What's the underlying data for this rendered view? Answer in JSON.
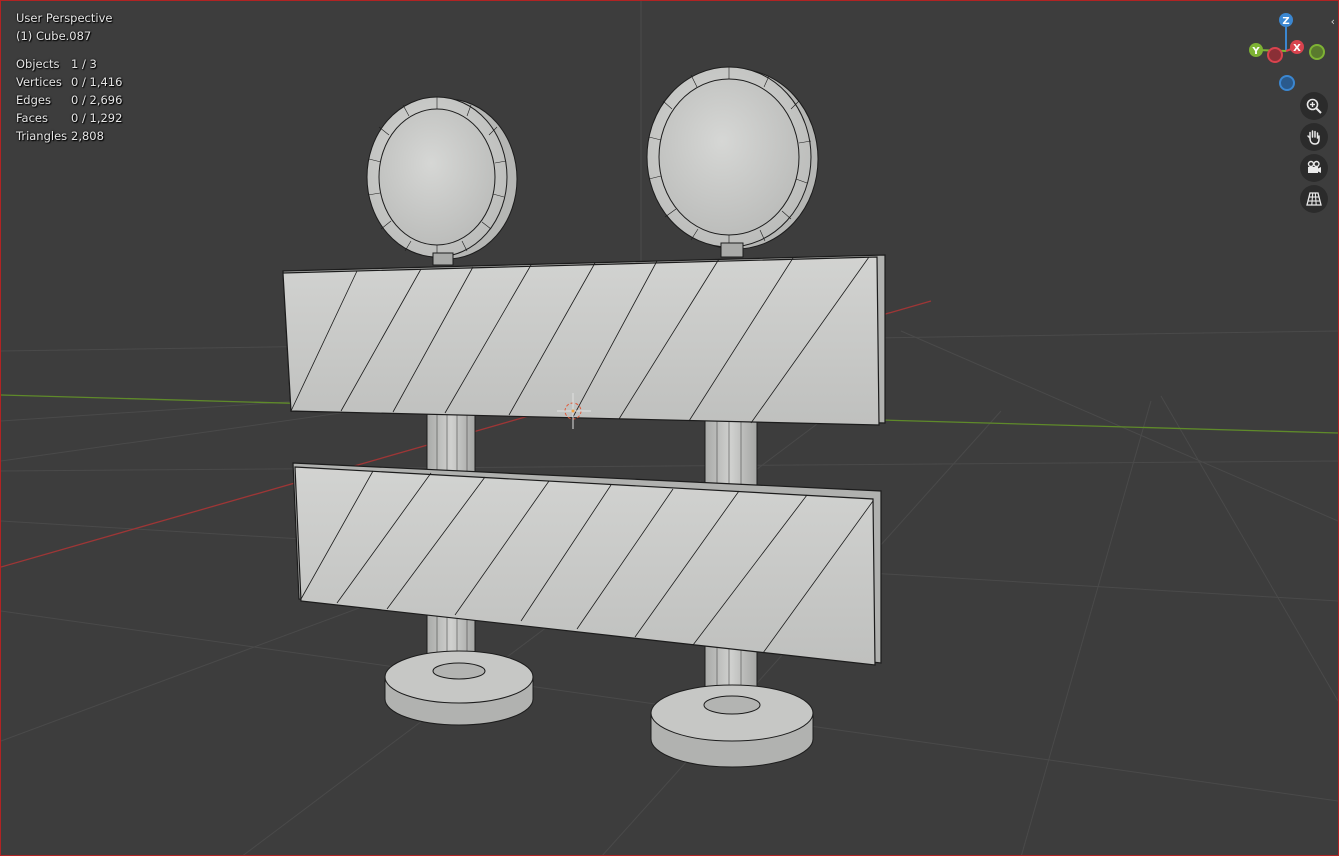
{
  "viewport": {
    "view_name": "User Perspective",
    "object_name": "(1) Cube.087"
  },
  "stats": [
    {
      "label": "Objects",
      "value": "1 / 3"
    },
    {
      "label": "Vertices",
      "value": "0 / 1,416"
    },
    {
      "label": "Edges",
      "value": "0 / 2,696"
    },
    {
      "label": "Faces",
      "value": "0 / 1,292"
    },
    {
      "label": "Triangles",
      "value": "2,808"
    }
  ],
  "axis_gizmo": {
    "z_label": "Z",
    "y_label": "Y",
    "x_label": "X",
    "colors": {
      "x": "#d8434e",
      "y": "#7eb334",
      "z": "#3b87d1"
    }
  },
  "nav_buttons": [
    {
      "name": "zoom",
      "icon": "zoom-icon"
    },
    {
      "name": "pan",
      "icon": "hand-pan-icon"
    },
    {
      "name": "camera",
      "icon": "camera-view-icon"
    },
    {
      "name": "ortho",
      "icon": "perspective-grid-icon"
    }
  ],
  "colors": {
    "background": "#3d3d3d",
    "grid": "#4b4b4b",
    "x_axis": "#9e3636",
    "y_axis": "#5f8a2a",
    "mesh": "#c9cac8",
    "wire": "#1a1a1a"
  }
}
